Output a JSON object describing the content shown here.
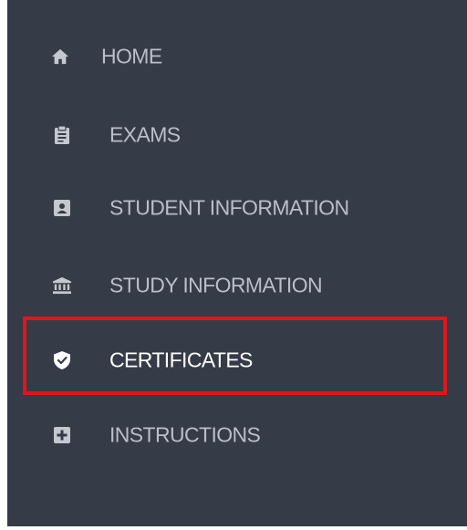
{
  "nav": {
    "items": [
      {
        "label": "HOME",
        "icon": "home-icon"
      },
      {
        "label": "EXAMS",
        "icon": "clipboard-icon"
      },
      {
        "label": "STUDENT INFORMATION",
        "icon": "id-card-icon"
      },
      {
        "label": "STUDY INFORMATION",
        "icon": "institution-icon"
      },
      {
        "label": "CERTIFICATES",
        "icon": "shield-check-icon"
      },
      {
        "label": "INSTRUCTIONS",
        "icon": "plus-square-icon"
      }
    ],
    "active_index": 4
  },
  "colors": {
    "sidebar_bg": "#353b47",
    "label_color": "#b9bec8",
    "active_label_color": "#ffffff",
    "highlight_border": "#e3141b"
  }
}
